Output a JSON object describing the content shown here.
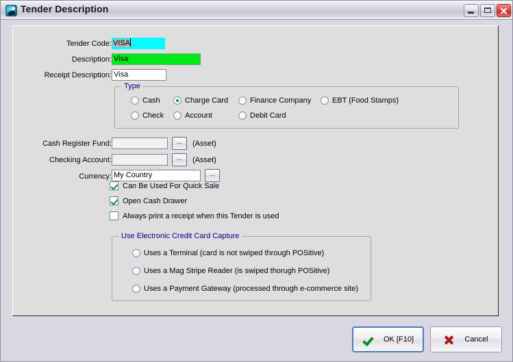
{
  "window": {
    "title": "Tender Description",
    "icon": "app-swirl-icon",
    "controls": {
      "minimize": "Minimize",
      "maximize": "Maximize",
      "close": "Close"
    }
  },
  "form": {
    "tender_code": {
      "label": "Tender Code:",
      "value": "VISA",
      "selected": true,
      "background": "#00ffff"
    },
    "description": {
      "label": "Description:",
      "value": "Visa",
      "background": "#00e818"
    },
    "receipt_description": {
      "label": "Receipt Description:",
      "value": "Visa",
      "background": "#ffffff"
    },
    "cash_register_fund": {
      "label": "Cash Register Fund:",
      "value": "",
      "browse": "...",
      "suffix": "(Asset)"
    },
    "checking_account": {
      "label": "Checking Account:",
      "value": "",
      "browse": "...",
      "suffix": "(Asset)"
    },
    "currency": {
      "label": "Currency:",
      "value": "My Country",
      "browse": "..."
    }
  },
  "type_group": {
    "title": "Type",
    "options": [
      {
        "label": "Cash",
        "checked": false
      },
      {
        "label": "Charge Card",
        "checked": true
      },
      {
        "label": "Finance Company",
        "checked": false
      },
      {
        "label": "EBT (Food Stamps)",
        "checked": false
      },
      {
        "label": "Check",
        "checked": false
      },
      {
        "label": "Account",
        "checked": false
      },
      {
        "label": "Debit Card",
        "checked": false
      }
    ]
  },
  "checkboxes": [
    {
      "label": "Can Be Used For Quick Sale",
      "checked": true
    },
    {
      "label": "Open Cash Drawer",
      "checked": true
    },
    {
      "label": "Always print a receipt when this Tender is used",
      "checked": false
    }
  ],
  "capture_group": {
    "title": "Use Electronic Credit Card Capture",
    "options": [
      {
        "label": "Uses a Terminal (card is not swiped through POSitive)",
        "checked": false
      },
      {
        "label": "Uses a Mag Stripe Reader (is swiped thorugh POSitive)",
        "checked": false
      },
      {
        "label": "Uses a Payment Gateway (processed through e-commerce site)",
        "checked": false
      }
    ]
  },
  "buttons": {
    "ok": "OK [F10]",
    "cancel": "Cancel"
  },
  "colors": {
    "title_text": "#15151f",
    "group_label": "#00008b",
    "checkmark_green": "#17922f",
    "cancel_red": "#a81818",
    "field_green": "#00e818",
    "field_cyan": "#00ffff",
    "focus_border": "#4f7ab5"
  }
}
